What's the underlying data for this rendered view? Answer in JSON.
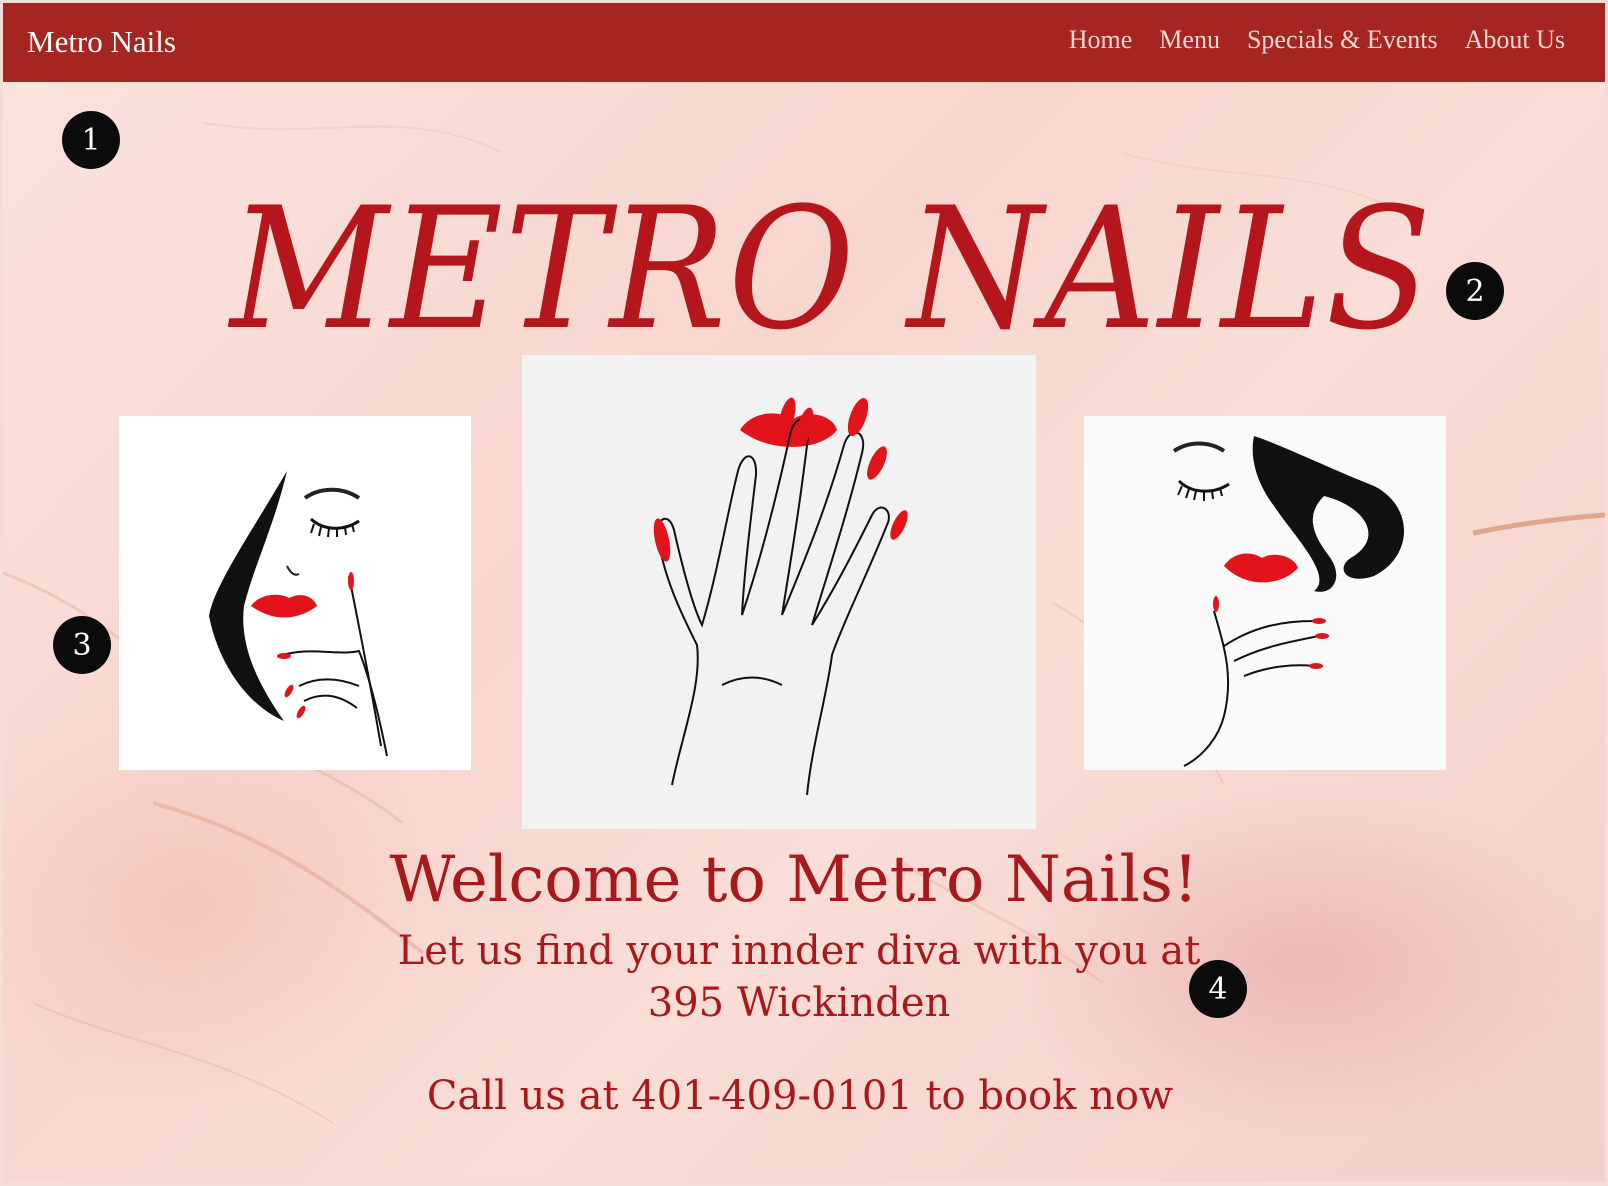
{
  "nav": {
    "brand": "Metro Nails",
    "links": [
      "Home",
      "Menu",
      "Specials & Events",
      "About Us"
    ]
  },
  "hero": {
    "title": "METRO NAILS"
  },
  "images": {
    "left_icon": "woman-face-hand-illustration",
    "center_icon": "hand-red-nails-lips-illustration",
    "right_icon": "woman-face-hair-illustration"
  },
  "content": {
    "welcome": "Welcome to Metro Nails!",
    "tagline_line1": "Let us find your innder diva with you at",
    "tagline_line2": "395 Wickinden",
    "call": "Call us at 401-409-0101 to book now"
  },
  "markers": [
    "1",
    "2",
    "3",
    "4"
  ],
  "colors": {
    "navbar": "#a52621",
    "accent_red": "#b5161b",
    "background": "#f6dcd6"
  }
}
